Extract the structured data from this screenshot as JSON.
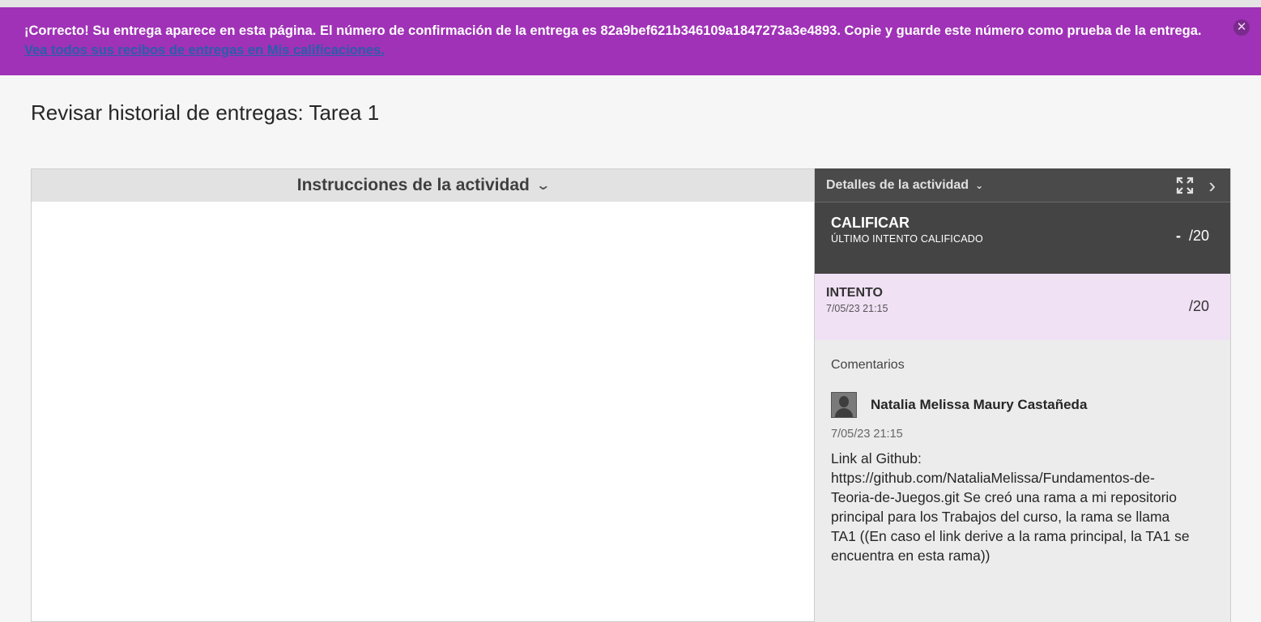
{
  "banner": {
    "message": "¡Correcto! Su entrega aparece en esta página. El número de confirmación de la entrega es 82a9bef621b346109a1847273a3e4893. Copie y guarde este número como prueba de la entrega.",
    "link_text": "Vea todos sus recibos de entregas en Mis calificaciones.",
    "close_icon": "close-icon"
  },
  "page": {
    "title": "Revisar historial de entregas: Tarea 1"
  },
  "instructions": {
    "header": "Instrucciones de la actividad",
    "chevron": "❯"
  },
  "details": {
    "title": "Detalles de la actividad",
    "chevron": "⌄",
    "icons": [
      "expand-icon",
      "chevron-right-icon"
    ],
    "next_glyph": "›"
  },
  "grade": {
    "label": "CALIFICAR",
    "sublabel": "ÚLTIMO INTENTO CALIFICADO",
    "value": "-",
    "max": "/20"
  },
  "attempt": {
    "label": "INTENTO",
    "date": "7/05/23 21:15",
    "score": "/20"
  },
  "comments": {
    "title": "Comentarios",
    "author": "Natalia Melissa Maury Castañeda",
    "date": "7/05/23 21:15",
    "text": "Link al Github:\nhttps://github.com/NataliaMelissa/Fundamentos-de-\nTeoria-de-Juegos.git Se creó una rama a mi repositorio\nprincipal para los Trabajos del curso, la rama se llama\nTA1 ((En caso el link derive a la rama principal, la TA1 se\nencuentra en esta rama))"
  },
  "colors": {
    "banner": "#a032b7",
    "dark_panel": "#444444",
    "attempt_bg": "#f1e1f5"
  }
}
